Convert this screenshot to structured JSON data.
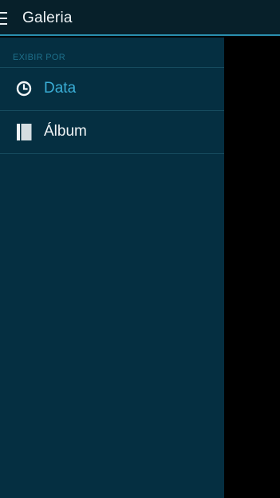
{
  "header": {
    "title": "Galeria",
    "menu_icon": "hamburger-menu-icon"
  },
  "drawer": {
    "section_header": "EXIBIR POR",
    "items": [
      {
        "label": "Data",
        "icon": "clock-icon",
        "selected": true
      },
      {
        "label": "Álbum",
        "icon": "album-icon",
        "selected": false
      }
    ]
  },
  "colors": {
    "accent": "#3aaed6",
    "drawer_background": "#052f41",
    "header_background": "#07202a",
    "header_border": "#2a8fae"
  }
}
